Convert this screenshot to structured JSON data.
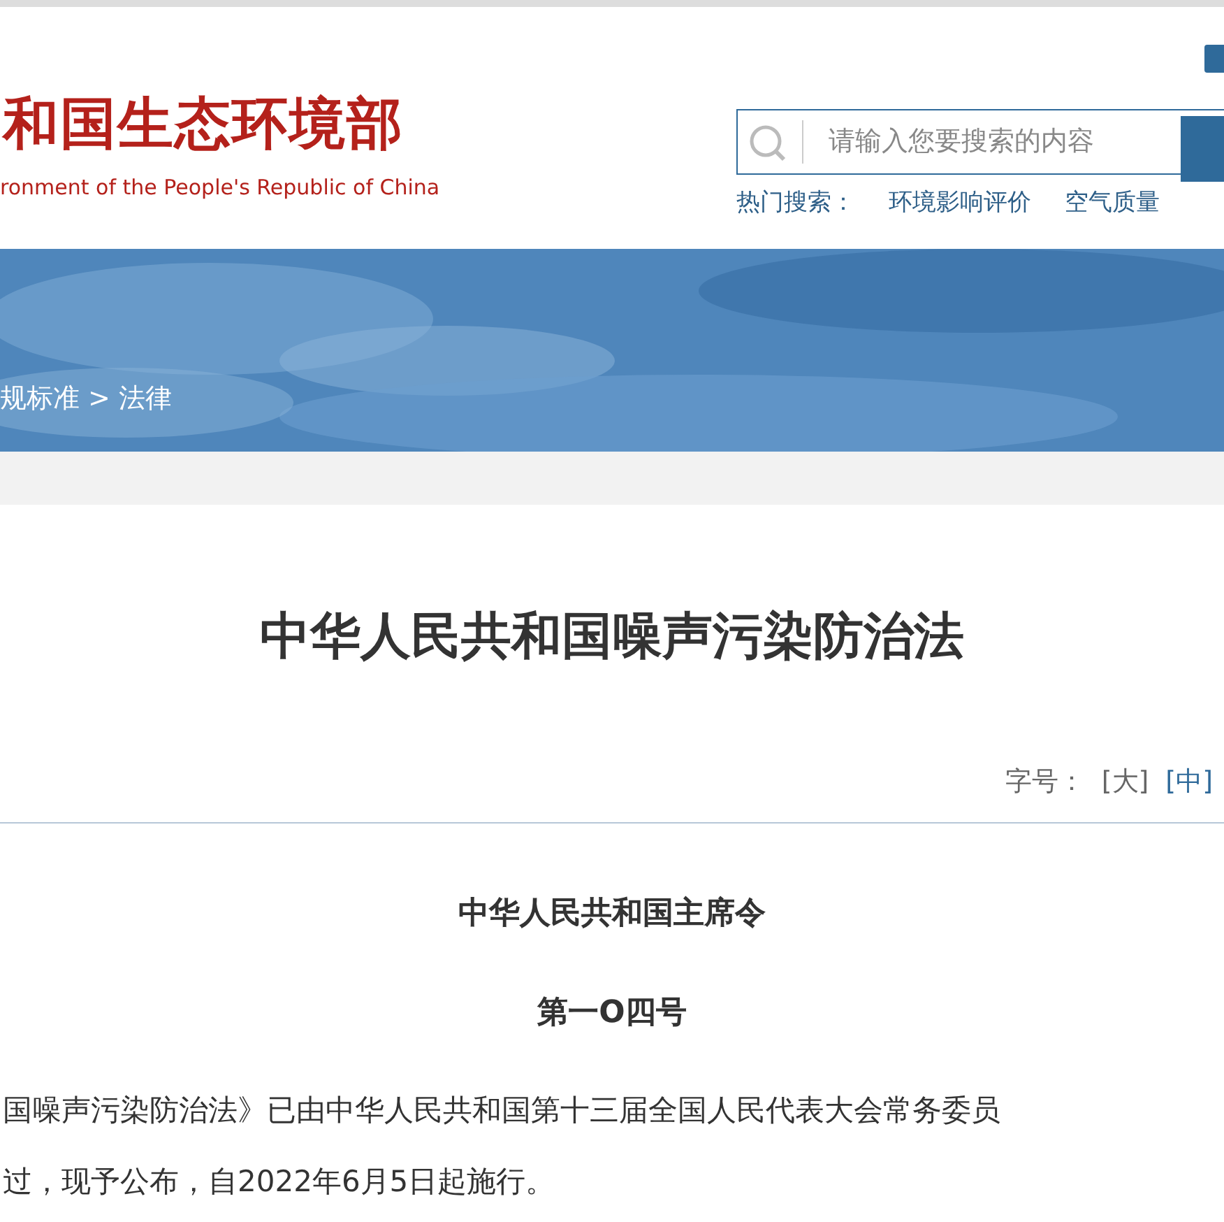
{
  "header": {
    "logo_title": "和国生态环境部",
    "logo_subtitle": "ronment of the People's Republic of China",
    "search": {
      "placeholder": "请输入您要搜索的内容"
    },
    "hot_search": {
      "label": "热门搜索：",
      "links": [
        "环境影响评价",
        "空气质量"
      ]
    }
  },
  "breadcrumb": {
    "items": [
      "规标准",
      "法律"
    ],
    "separator": ">"
  },
  "article": {
    "title": "中华人民共和国噪声污染防治法",
    "font_size": {
      "label": "字号：",
      "options": [
        {
          "label": "[大]",
          "selected": false
        },
        {
          "label": "[中]",
          "selected": true
        }
      ]
    },
    "headings": [
      "中华人民共和国主席令",
      "第一O四号"
    ],
    "paragraph_lines": [
      "国噪声污染防治法》已由中华人民共和国第十三届全国人民代表大会常务委员",
      "过，现予公布，自2022年6月5日起施行。"
    ]
  }
}
